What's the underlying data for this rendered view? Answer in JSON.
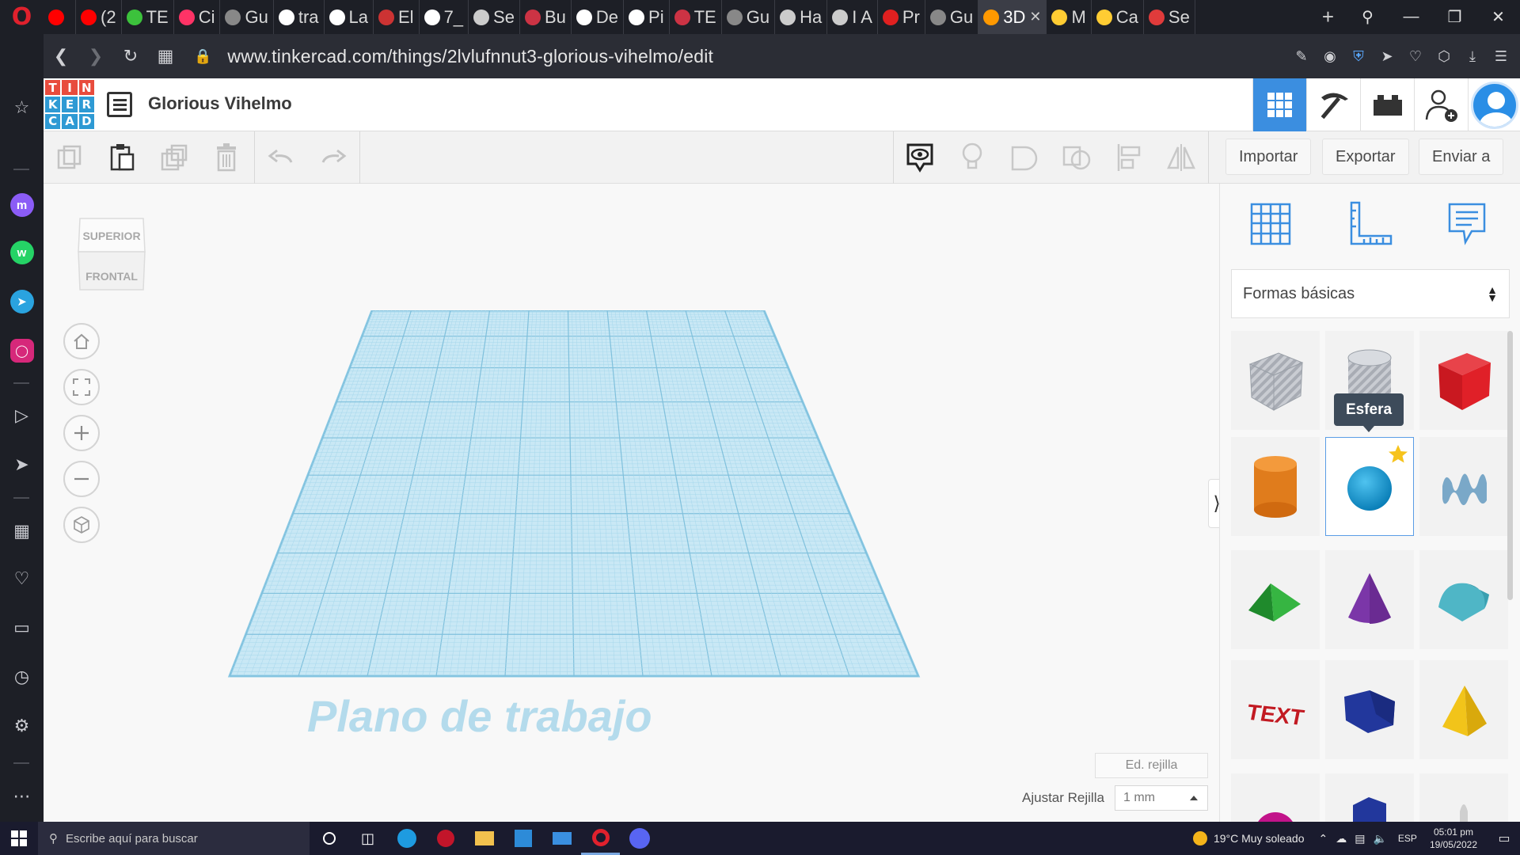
{
  "browser": {
    "tabs": [
      {
        "label": "",
        "color": "#ff0000"
      },
      {
        "label": "(2",
        "color": "#ff0000"
      },
      {
        "label": "TE",
        "color": "#3cc23c"
      },
      {
        "label": "Ci",
        "color": "#ff3366"
      },
      {
        "label": "Gu",
        "color": "#888888"
      },
      {
        "label": "tra",
        "color": "#ffffff"
      },
      {
        "label": "La",
        "color": "#ffffff"
      },
      {
        "label": "El",
        "color": "#cc3333"
      },
      {
        "label": "7_",
        "color": "#ffffff"
      },
      {
        "label": "Se",
        "color": "#cccccc"
      },
      {
        "label": "Bu",
        "color": "#cc3344"
      },
      {
        "label": "De",
        "color": "#ffffff"
      },
      {
        "label": "Pi",
        "color": "#ffffff"
      },
      {
        "label": "TE",
        "color": "#cc3344"
      },
      {
        "label": "Gu",
        "color": "#888888"
      },
      {
        "label": "Ha",
        "color": "#cccccc"
      },
      {
        "label": "I A",
        "color": "#cccccc"
      },
      {
        "label": "Pr",
        "color": "#e02020"
      },
      {
        "label": "Gu",
        "color": "#888888"
      },
      {
        "label": "3D",
        "color": "#ff9900",
        "active": true
      },
      {
        "label": "M",
        "color": "#ffcc33"
      },
      {
        "label": "Ca",
        "color": "#ffcc33"
      },
      {
        "label": "Se",
        "color": "#e03b3b"
      }
    ],
    "url": "www.tinkercad.com/things/2lvlufnnut3-glorious-vihelmo/edit"
  },
  "app": {
    "logo_letters": [
      "T",
      "I",
      "N",
      "K",
      "E",
      "R",
      "C",
      "A",
      "D"
    ],
    "logo_colors": [
      "#e84c3d",
      "#e84c3d",
      "#e84c3d",
      "#2e9ad4",
      "#2e9ad4",
      "#2e9ad4",
      "#2e9ad4",
      "#2e9ad4",
      "#2e9ad4"
    ],
    "title": "Glorious Vihelmo",
    "accent": "#3b8ee0"
  },
  "toolbar": {
    "import_label": "Importar",
    "export_label": "Exportar",
    "send_label": "Enviar a"
  },
  "viewcube": {
    "top_label": "SUPERIOR",
    "front_label": "FRONTAL"
  },
  "workspace": {
    "workplane_label": "Plano de trabajo",
    "edit_grid_label": "Ed. rejilla",
    "snap_label": "Ajustar Rejilla",
    "snap_value": "1 mm"
  },
  "panel": {
    "category": "Formas básicas",
    "tooltip": "Esfera",
    "shapes": [
      "box-hole",
      "cylinder-hole",
      "box",
      "cylinder",
      "sphere",
      "scribble",
      "roof",
      "cone",
      "round-roof",
      "text",
      "half-cylinder",
      "pyramid"
    ]
  },
  "taskbar": {
    "search_placeholder": "Escribe aquí para buscar",
    "weather": "19°C  Muy soleado",
    "lang": "ESP",
    "time": "05:01 pm",
    "date": "19/05/2022"
  }
}
